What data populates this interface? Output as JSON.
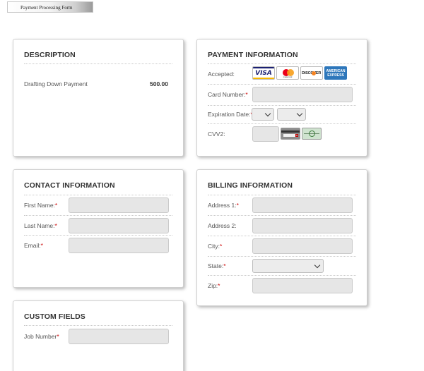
{
  "form_tab": "Payment Processing Form",
  "description": {
    "title": "DESCRIPTION",
    "item_label": "Drafting Down Payment",
    "amount": "500.00"
  },
  "payment": {
    "title": "PAYMENT INFORMATION",
    "accepted_label": "Accepted:",
    "cards": [
      {
        "name": "visa-icon",
        "text": "VISA"
      },
      {
        "name": "mastercard-icon",
        "text": "mastercard"
      },
      {
        "name": "discover-icon",
        "text": "DISCOVER"
      },
      {
        "name": "amex-icon",
        "text": "AMERICAN EXPRESS"
      }
    ],
    "card_number_label": "Card Number:",
    "expiration_label": "Expiration Date:",
    "cvv_label": "CVV2:",
    "required_mark": "*"
  },
  "contact": {
    "title": "CONTACT INFORMATION",
    "first_name_label": "First Name:",
    "last_name_label": "Last Name:",
    "email_label": "Email:"
  },
  "billing": {
    "title": "BILLING INFORMATION",
    "address1_label": "Address 1:",
    "address2_label": "Address 2:",
    "city_label": "City:",
    "state_label": "State:",
    "zip_label": "Zip:"
  },
  "custom": {
    "title": "CUSTOM FIELDS",
    "job_number_label": "Job Number"
  },
  "colors": {
    "required": "#cc0000",
    "field_bg": "#e6e6e6",
    "visa_blue": "#1a1f71",
    "visa_gold": "#f7b600",
    "amex_blue": "#2e77bb"
  }
}
